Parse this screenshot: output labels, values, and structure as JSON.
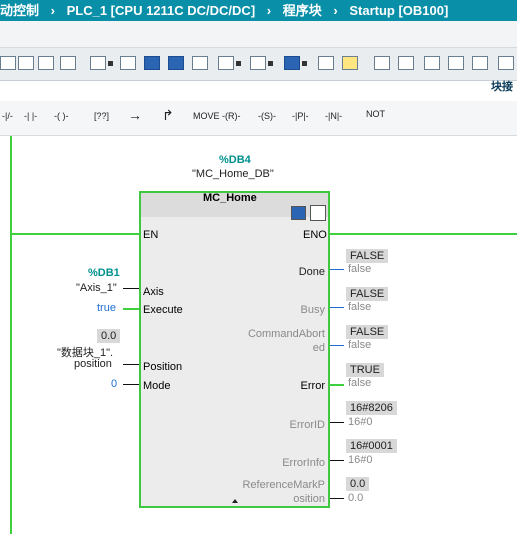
{
  "title": {
    "part1": "动控制",
    "part2": "PLC_1 [CPU 1211C DC/DC/DC]",
    "part3": "程序块",
    "part4": "Startup [OB100]",
    "sep": "›"
  },
  "toolbar": {
    "right_label": "块接",
    "icons": [
      "network-insert-icon",
      "network-delete-icon",
      "network-copy-icon",
      "network-paste-icon",
      "upload-icon",
      "list-icon",
      "window-icon",
      "window2-icon",
      "comment-icon",
      "goto-icon",
      "monitor-icon",
      "overview-icon",
      "list2-icon",
      "favorite-icon",
      "call-icon",
      "call2-icon",
      "modify-icon",
      "modify2-icon",
      "refresh-icon"
    ]
  },
  "ladder": {
    "items": [
      "-|/-",
      "-| |-",
      "-( )-",
      "[??]",
      "→",
      "↱",
      "MOVE",
      "-(R)-",
      "-(S)-",
      "-|P|-",
      "-|N|-",
      "NOT"
    ]
  },
  "block": {
    "instance_db": "%DB4",
    "instance_name": "\"MC_Home_DB\"",
    "name": "MC_Home",
    "en": "EN",
    "eno": "ENO",
    "axis_db": "%DB1",
    "axis_name": "\"Axis_1\"",
    "axis_label": "Axis",
    "execute_value": "true",
    "execute_label": "Execute",
    "position_value": "0.0",
    "position_tag1": "\"数据块_1\".",
    "position_tag2": "position",
    "position_label": "Position",
    "mode_value": "0",
    "mode_label": "Mode",
    "outputs": {
      "done_label": "Done",
      "done_monitor": "FALSE",
      "done_value": "false",
      "busy_label": "Busy",
      "busy_monitor": "FALSE",
      "busy_value": "false",
      "cmdabort_label1": "CommandAbort",
      "cmdabort_label2": "ed",
      "cmdabort_monitor": "FALSE",
      "cmdabort_value": "false",
      "error_label": "Error",
      "error_monitor": "TRUE",
      "error_value": "false",
      "errorid_label": "ErrorID",
      "errorid_monitor": "16#8206",
      "errorid_value": "16#0",
      "errorinfo_label": "ErrorInfo",
      "errorinfo_monitor": "16#0001",
      "errorinfo_value": "16#0",
      "refmark_label1": "ReferenceMarkP",
      "refmark_label2": "osition",
      "refmark_monitor": "0.0",
      "refmark_value": "0.0"
    }
  },
  "colors": {
    "title_bg": "#0a8fa8",
    "green": "#40c840",
    "teal": "#008f8f",
    "blue": "#1f6fd0"
  }
}
